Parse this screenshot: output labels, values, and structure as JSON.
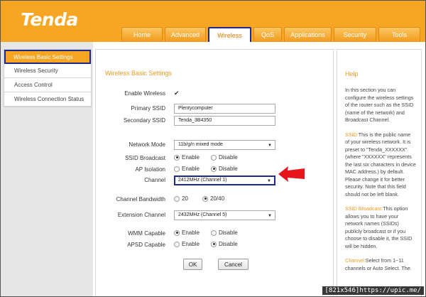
{
  "brand": {
    "logo": "Tenda"
  },
  "tabs": [
    {
      "label": "Home"
    },
    {
      "label": "Advanced"
    },
    {
      "label": "Wireless"
    },
    {
      "label": "QoS"
    },
    {
      "label": "Applications"
    },
    {
      "label": "Security"
    },
    {
      "label": "Tools"
    }
  ],
  "active_tab": "Wireless",
  "sidebar": {
    "items": [
      {
        "label": "Wireless Basic Settings"
      },
      {
        "label": "Wireless Security"
      },
      {
        "label": "Access Control"
      },
      {
        "label": "Wireless Connection Status"
      }
    ],
    "active": "Wireless Basic Settings"
  },
  "form": {
    "title": "Wireless Basic Settings",
    "enable_wireless": {
      "label": "Enable Wireless",
      "checked": true
    },
    "primary_ssid": {
      "label": "Primary SSID",
      "value": "Plentycomputer"
    },
    "secondary_ssid": {
      "label": "Secondary SSID",
      "value": "Tenda_3B4350"
    },
    "network_mode": {
      "label": "Network Mode",
      "value": "11b/g/n mixed mode"
    },
    "ssid_broadcast": {
      "label": "SSID Broadcast",
      "enable": "Enable",
      "disable": "Disable",
      "selected": "Enable"
    },
    "ap_isolation": {
      "label": "AP Isolation",
      "enable": "Enable",
      "disable": "Disable",
      "selected": "Disable"
    },
    "channel": {
      "label": "Channel",
      "value": "2412MHz (Channel 1)"
    },
    "channel_bandwidth": {
      "label": "Channel Bandwidth",
      "opt1": "20",
      "opt2": "20/40",
      "selected": "20/40"
    },
    "extension_channel": {
      "label": "Extension Channel",
      "value": "2432MHz (Channel 5)"
    },
    "wmm_capable": {
      "label": "WMM Capable",
      "enable": "Enable",
      "disable": "Disable",
      "selected": "Enable"
    },
    "apsd_capable": {
      "label": "APSD Capable",
      "enable": "Enable",
      "disable": "Disable",
      "selected": "Disable"
    },
    "ok_label": "OK",
    "cancel_label": "Cancel"
  },
  "help": {
    "title": "Help",
    "intro": "In this section you can configure the wireless settings of the router such as the SSID (name of the network) and Broadcast Channel.",
    "ssid_kw": "SSID:",
    "ssid_text": "This is the public name of your wireless network. It is preset to \"Tenda_XXXXXX\" (where \"XXXXXX\" represents the last six characters in device MAC address.) by default. Please change it for better security. Note that this field should not be left blank.",
    "broadcast_kw": "SSID Broadcast:",
    "broadcast_text": "This option allows you to have your network names (SSIDs) publicly broadcast or if you choose to disable it, the SSID will be hidden.",
    "channel_kw": "Channel:",
    "channel_text": "Select from 1~11 channels or Auto Select. The"
  },
  "watermark": "[821x546]https://upic.me/",
  "colors": {
    "orange": "#f6a623",
    "highlight": "#1d2a8c",
    "arrow": "#e8141c"
  }
}
